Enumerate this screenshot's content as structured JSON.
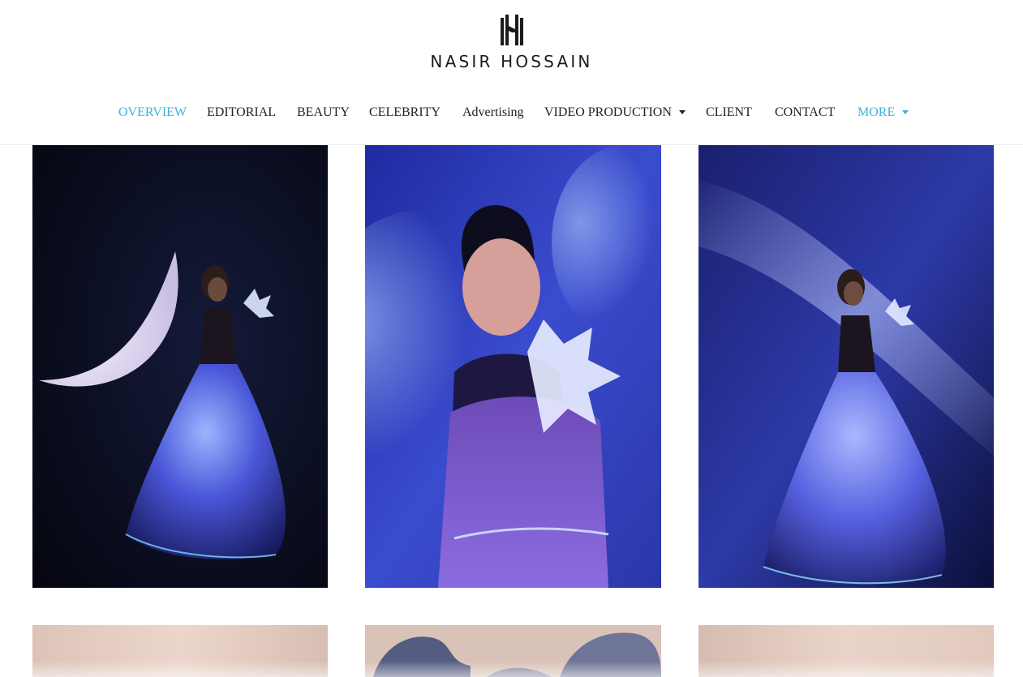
{
  "brand": {
    "name": "NASIR HOSSAIN",
    "logo_icon": "nh-monogram-icon"
  },
  "nav": {
    "items": [
      {
        "label": "OVERVIEW",
        "active": true
      },
      {
        "label": "EDITORIAL"
      },
      {
        "label": "BEAUTY"
      },
      {
        "label": "CELEBRITY"
      },
      {
        "label": "Advertising"
      },
      {
        "label": "VIDEO PRODUCTION",
        "dropdown": true
      },
      {
        "label": "CLIENT"
      },
      {
        "label": "CONTACT"
      },
      {
        "label": "MORE",
        "dropdown": true
      }
    ],
    "dropdown_icon": "caret-down-icon"
  },
  "colors": {
    "accent": "#3bb3d6",
    "nav_text": "#222222",
    "background": "#ffffff"
  },
  "gallery": {
    "photos": [
      {
        "subject": "model in glowing blue gown with crescent moon"
      },
      {
        "subject": "close-up portrait holding glowing flower"
      },
      {
        "subject": "model in glowing gown against milky way"
      },
      {
        "subject": "beige backdrop"
      },
      {
        "subject": "flowing blue fabric"
      },
      {
        "subject": "beige backdrop"
      }
    ]
  }
}
